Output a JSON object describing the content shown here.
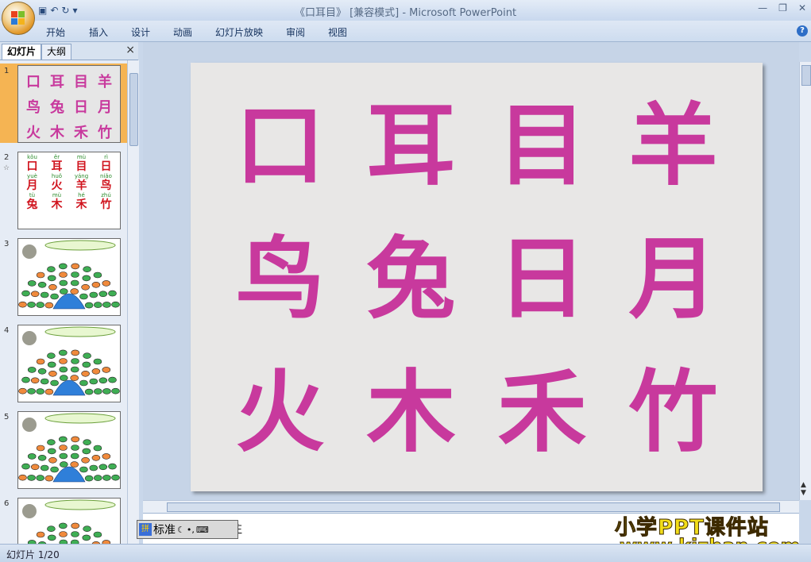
{
  "window": {
    "title": "《口耳目》 [兼容模式] - Microsoft PowerPoint",
    "qat_icons": [
      "save-icon",
      "undo-icon",
      "redo-icon",
      "customize-icon"
    ]
  },
  "ribbon": {
    "tabs": [
      "开始",
      "插入",
      "设计",
      "动画",
      "幻灯片放映",
      "审阅",
      "视图"
    ]
  },
  "panel": {
    "tab_slides": "幻灯片",
    "tab_outline": "大纲",
    "close": "×"
  },
  "thumbnails": {
    "numbers": [
      "1",
      "2",
      "3",
      "4",
      "5",
      "6"
    ],
    "slide1_chars": [
      "口",
      "耳",
      "目",
      "羊",
      "鸟",
      "兔",
      "日",
      "月",
      "火",
      "木",
      "禾",
      "竹"
    ],
    "slide2_cells": [
      {
        "py": "kǒu",
        "hz": "口"
      },
      {
        "py": "ěr",
        "hz": "耳"
      },
      {
        "py": "mù",
        "hz": "目"
      },
      {
        "py": "rì",
        "hz": "日"
      },
      {
        "py": "yuè",
        "hz": "月"
      },
      {
        "py": "huǒ",
        "hz": "火"
      },
      {
        "py": "yáng",
        "hz": "羊"
      },
      {
        "py": "niǎo",
        "hz": "鸟"
      },
      {
        "py": "tù",
        "hz": "兔"
      },
      {
        "py": "mù",
        "hz": "木"
      },
      {
        "py": "hé",
        "hz": "禾"
      },
      {
        "py": "zhú",
        "hz": "竹"
      }
    ]
  },
  "slide": {
    "chars": [
      "口",
      "耳",
      "目",
      "羊",
      "鸟",
      "兔",
      "日",
      "月",
      "火",
      "木",
      "禾",
      "竹"
    ]
  },
  "notes": {
    "text": "注"
  },
  "ime": {
    "mode": "标准"
  },
  "status": {
    "slide_counter": "幻灯片 1/20"
  },
  "watermark": {
    "line1": "小学PPT课件站",
    "line2": "www.kjzhan.com"
  },
  "colors": {
    "char_magenta": "#c8399d",
    "pinyin_green": "#2a8b2a",
    "hanzi_red": "#d0141e",
    "selected_thumb": "#f5b453"
  }
}
